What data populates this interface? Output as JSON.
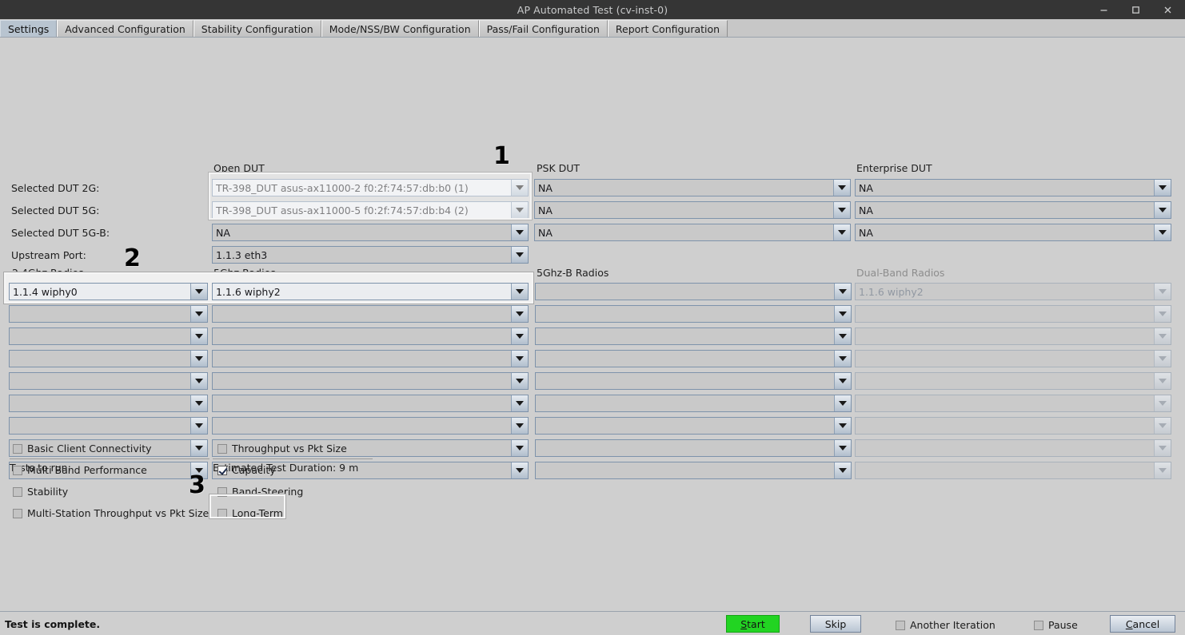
{
  "window": {
    "title": "AP Automated Test  (cv-inst-0)",
    "controls": [
      {
        "name": "minimize-button",
        "glyph": "minimize"
      },
      {
        "name": "maximize-button",
        "glyph": "maximize"
      },
      {
        "name": "close-button",
        "glyph": "close"
      }
    ]
  },
  "tabs": [
    {
      "label": "Settings",
      "active": true
    },
    {
      "label": "Advanced Configuration",
      "active": false
    },
    {
      "label": "Stability Configuration",
      "active": false
    },
    {
      "label": "Mode/NSS/BW Configuration",
      "active": false
    },
    {
      "label": "Pass/Fail Configuration",
      "active": false
    },
    {
      "label": "Report Configuration",
      "active": false
    }
  ],
  "dut_section": {
    "row_labels": [
      "Selected DUT 2G:",
      "Selected DUT 5G:",
      "Selected DUT 5G-B:",
      "Upstream Port:"
    ],
    "columns": [
      {
        "group_label": "Open DUT",
        "disabled": false,
        "values": [
          "TR-398_DUT asus-ax11000-2 f0:2f:74:57:db:b0 (1)",
          "TR-398_DUT asus-ax11000-5 f0:2f:74:57:db:b4 (2)",
          "NA",
          "1.1.3 eth3"
        ]
      },
      {
        "group_label": "PSK DUT",
        "disabled": false,
        "values": [
          "NA",
          "NA",
          "NA"
        ]
      },
      {
        "group_label": "Enterprise DUT",
        "disabled": false,
        "values": [
          "NA",
          "NA",
          "NA"
        ]
      }
    ]
  },
  "radio_section": {
    "columns": [
      {
        "group_label": "2.4Ghz Radios",
        "disabled": false,
        "values": [
          "1.1.4 wiphy0",
          "",
          "",
          "",
          "",
          "",
          "",
          "",
          ""
        ]
      },
      {
        "group_label": "5Ghz Radios",
        "disabled": false,
        "values": [
          "1.1.6 wiphy2",
          "",
          "",
          "",
          "",
          "",
          "",
          "",
          ""
        ]
      },
      {
        "group_label": "5Ghz-B Radios",
        "disabled": false,
        "values": [
          "",
          "",
          "",
          "",
          "",
          "",
          "",
          "",
          ""
        ]
      },
      {
        "group_label": "Dual-Band Radios",
        "disabled": true,
        "values": [
          "1.1.6 wiphy2",
          "",
          "",
          "",
          "",
          "",
          "",
          "",
          ""
        ]
      }
    ]
  },
  "tests": {
    "heading": "Tests to run:",
    "duration": "Estimated Test Duration: 9 m",
    "left_column": [
      {
        "label": "Basic Client Connectivity",
        "checked": false
      },
      {
        "label": "Multi Band Performance",
        "checked": false
      },
      {
        "label": "Stability",
        "checked": false
      },
      {
        "label": "Multi-Station Throughput vs Pkt Size",
        "checked": false
      }
    ],
    "right_column": [
      {
        "label": "Throughput vs Pkt Size",
        "checked": false
      },
      {
        "label": "Capacity",
        "checked": true
      },
      {
        "label": "Band-Steering",
        "checked": false
      },
      {
        "label": "Long-Term",
        "checked": false
      }
    ]
  },
  "callouts": [
    {
      "label": "1"
    },
    {
      "label": "2"
    },
    {
      "label": "3"
    }
  ],
  "footer": {
    "status": "Test is complete.",
    "start_label": "Start",
    "start_accel": "S",
    "start_rest": "tart",
    "skip_label": "Skip",
    "another_iteration_label": "Another Iteration",
    "another_iteration_checked": false,
    "pause_label": "Pause",
    "pause_checked": false,
    "cancel_accel": "C",
    "cancel_rest": "ancel",
    "cancel_label": "Cancel"
  },
  "colors": {
    "start_green": "#22d422",
    "titlebar": "#353535",
    "panel": "#cfcfcf",
    "active_tab": "#b8c4d0"
  }
}
